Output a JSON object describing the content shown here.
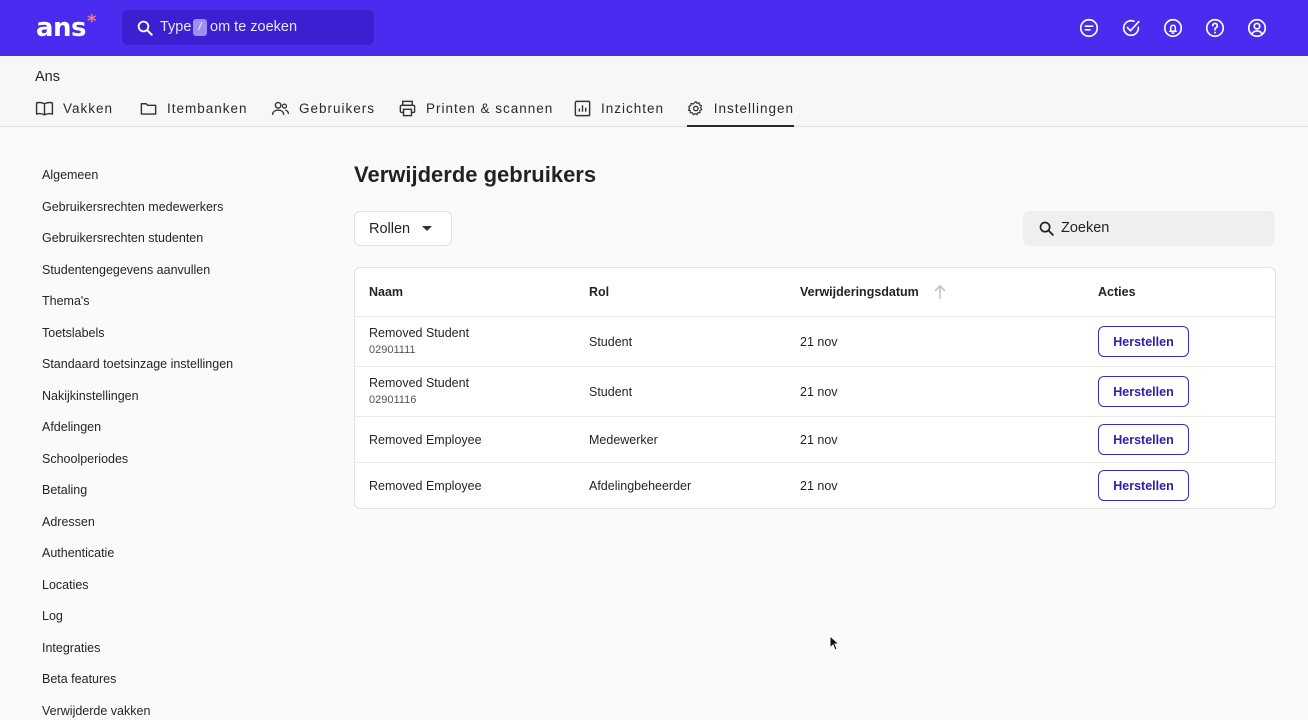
{
  "topbar": {
    "logo": "ans",
    "logo_mark": "*",
    "search": {
      "prefix": "Type",
      "key": "/",
      "suffix": "om te zoeken"
    },
    "icons": [
      "chat-icon",
      "check-circle-icon",
      "bell-icon",
      "help-icon",
      "user-icon"
    ]
  },
  "org_name": "Ans",
  "nav": [
    {
      "label": "Vakken",
      "icon": "book-icon"
    },
    {
      "label": "Itembanken",
      "icon": "folder-icon"
    },
    {
      "label": "Gebruikers",
      "icon": "users-icon"
    },
    {
      "label": "Printen & scannen",
      "icon": "printer-icon"
    },
    {
      "label": "Inzichten",
      "icon": "chart-icon"
    },
    {
      "label": "Instellingen",
      "icon": "gear-icon",
      "active": true
    }
  ],
  "sidebar": [
    "Algemeen",
    "Gebruikersrechten medewerkers",
    "Gebruikersrechten studenten",
    "Studentengegevens aanvullen",
    "Thema's",
    "Toetslabels",
    "Standaard toetsinzage instellingen",
    "Nakijkinstellingen",
    "Afdelingen",
    "Schoolperiodes",
    "Betaling",
    "Adressen",
    "Authenticatie",
    "Locaties",
    "Log",
    "Integraties",
    "Beta features",
    "Verwijderde vakken"
  ],
  "main": {
    "title": "Verwijderde gebruikers",
    "roles_filter": "Rollen",
    "search_placeholder": "Zoeken",
    "table": {
      "headers": [
        "Naam",
        "Rol",
        "Verwijderingsdatum",
        "Acties"
      ],
      "sort": "ascending",
      "rows": [
        {
          "name": "Removed Student",
          "id": "02901111",
          "role": "Student",
          "date": "21 nov",
          "action": "Herstellen"
        },
        {
          "name": "Removed Student",
          "id": "02901116",
          "role": "Student",
          "date": "21 nov",
          "action": "Herstellen"
        },
        {
          "name": "Removed Employee",
          "id": "",
          "role": "Medewerker",
          "date": "21 nov",
          "action": "Herstellen"
        },
        {
          "name": "Removed Employee",
          "id": "",
          "role": "Afdelingbeheerder",
          "date": "21 nov",
          "action": "Herstellen"
        }
      ]
    }
  },
  "colors": {
    "brand": "#4a2cf0",
    "action": "#2a1fa8"
  }
}
